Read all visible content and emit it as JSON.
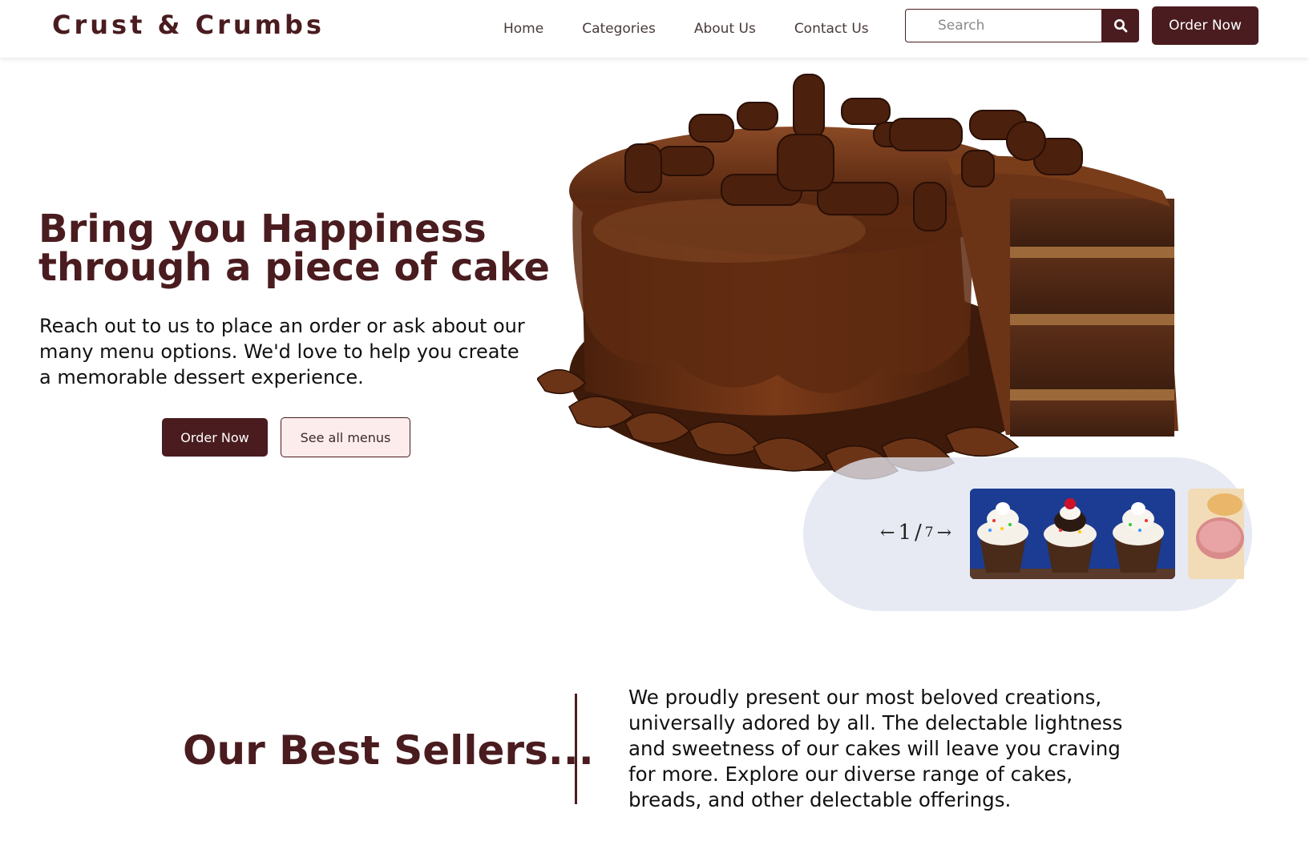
{
  "brand": {
    "name": "Crust & Crumbs"
  },
  "nav": {
    "links": [
      "Home",
      "Categories",
      "About Us",
      "Contact Us"
    ],
    "search_placeholder": "Search",
    "search_icon": "search-icon",
    "order_label": "Order Now"
  },
  "hero": {
    "title_line1": "Bring you Happiness",
    "title_line2": "through a piece of cake",
    "description": "Reach out to us to place an order or ask about our many menu options. We'd love to help you create a memorable dessert experience.",
    "primary_button": "Order Now",
    "secondary_button": "See all menus"
  },
  "carousel": {
    "counter_current": "1",
    "counter_total": "7",
    "prev_icon": "arrow-left-icon",
    "next_icon": "arrow-right-icon"
  },
  "best_sellers": {
    "title": "Our Best Sellers...",
    "text": "We proudly present our most beloved creations, universally adored by all. The delectable lightness and sweetness of our cakes will leave you craving for more. Explore our diverse range of cakes, breads, and other delectable offerings."
  },
  "colors": {
    "brand": "#4a1c1f",
    "secondary_button_bg": "#fdecec",
    "carousel_bg": "#e0e4f0"
  }
}
